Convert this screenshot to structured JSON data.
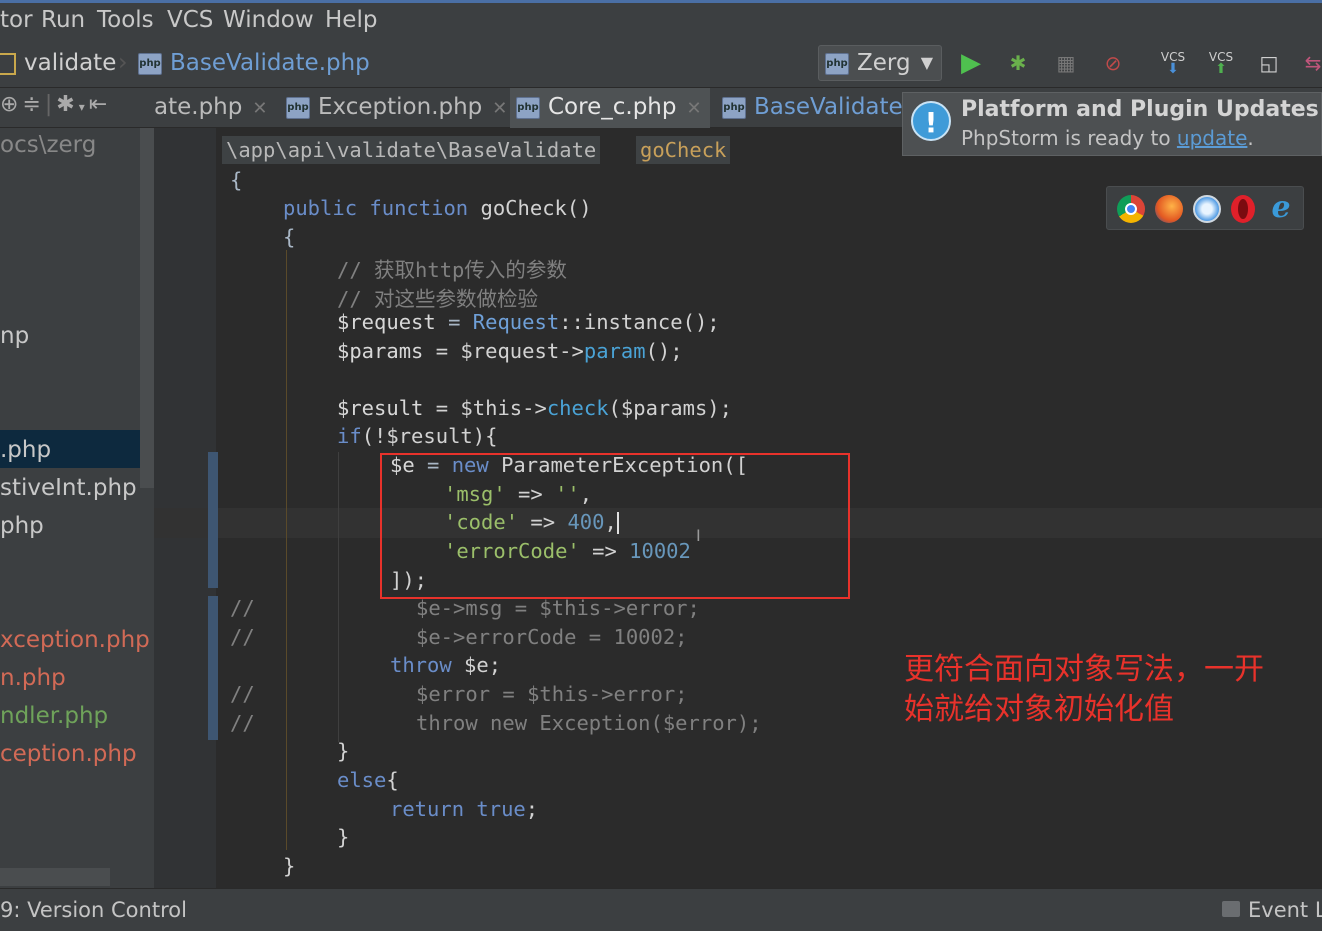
{
  "menu": {
    "items": [
      "tor",
      "Run",
      "Tools",
      "VCS",
      "Window",
      "Help"
    ]
  },
  "navbar": {
    "crumbs": [
      "validate",
      "BaseValidate.php"
    ],
    "run_config": "Zerg",
    "vcs_update_label": "VCS",
    "vcs_commit_label": "VCS"
  },
  "tabs": [
    {
      "label": "ate.php",
      "active": false
    },
    {
      "label": "Exception.php",
      "active": false
    },
    {
      "label": "Core_c.php",
      "active": true
    },
    {
      "label": "BaseValidate.p",
      "active": false
    }
  ],
  "project": {
    "path": "ocs\\zerg",
    "items": [
      {
        "label": "np",
        "color": "#c8c8c8"
      },
      {
        "label": ".php",
        "color": "#c8c8c8"
      },
      {
        "label": "stiveInt.php",
        "color": "#c8c8c8"
      },
      {
        "label": "php",
        "color": "#c8c8c8"
      },
      {
        "label": "xception.php",
        "color": "#d26a56"
      },
      {
        "label": "n.php",
        "color": "#d26a56"
      },
      {
        "label": "ndler.php",
        "color": "#6fa35a"
      },
      {
        "label": "ception.php",
        "color": "#d26a56"
      }
    ]
  },
  "editor": {
    "breadcrumb_path": "\\app\\api\\validate\\BaseValidate",
    "breadcrumb_method": "goCheck",
    "lines": {
      "l1": "{",
      "l2_kw1": "public",
      "l2_kw2": "function",
      "l2_name": "goCheck()",
      "l3": "{",
      "l4": "// 获取http传入的参数",
      "l5": "// 对这些参数做检验",
      "l6_var": "$request",
      "l6_eq": " = ",
      "l6_cls": "Request",
      "l6_rest": "::instance();",
      "l7_var": "$params",
      "l7_mid": " = $request->",
      "l7_meth": "param",
      "l7_rest": "();",
      "l8_var": "$result",
      "l8_mid": " = $this->",
      "l8_meth": "check",
      "l8_rest": "($params);",
      "l9_kw": "if",
      "l9_rest": "(!$result){",
      "l10_var": "$e",
      "l10_eq": " = ",
      "l10_kw": "new",
      "l10_rest": " ParameterException([",
      "l11_key": "'msg'",
      "l11_arrow": " => ",
      "l11_val": "''",
      "l11_end": ",",
      "l12_key": "'code'",
      "l12_arrow": " => ",
      "l12_val": "400",
      "l12_end": ",",
      "l13_key": "'errorCode'",
      "l13_arrow": " => ",
      "l13_val": "10002",
      "l14": "]);",
      "l15_cm": "//",
      "l15": "$e->msg = $this->error;",
      "l16_cm": "//",
      "l16": "$e->errorCode = 10002;",
      "l17_kw": "throw",
      "l17_rest": " $e;",
      "l18_cm": "//",
      "l18": "$error = $this->error;",
      "l19_cm": "//",
      "l19": "throw new Exception($error);",
      "l20": "}",
      "l21_kw": "else",
      "l21_rest": "{",
      "l22_kw1": "return",
      "l22_kw2": "true",
      "l22_rest": ";",
      "l23": "}",
      "l24": "}"
    }
  },
  "annotation": {
    "line1": "更符合面向对象写法，一开",
    "line2": "始就给对象初始化值",
    "color": "#e8322b"
  },
  "notification": {
    "title": "Platform and Plugin Updates",
    "text": "PhpStorm is ready to ",
    "link": "update",
    "end": "."
  },
  "browsers": [
    "chrome-icon",
    "firefox-icon",
    "safari-icon",
    "opera-icon",
    "ie-icon"
  ],
  "status": {
    "left": "9: Version Control",
    "right": "Event L"
  }
}
